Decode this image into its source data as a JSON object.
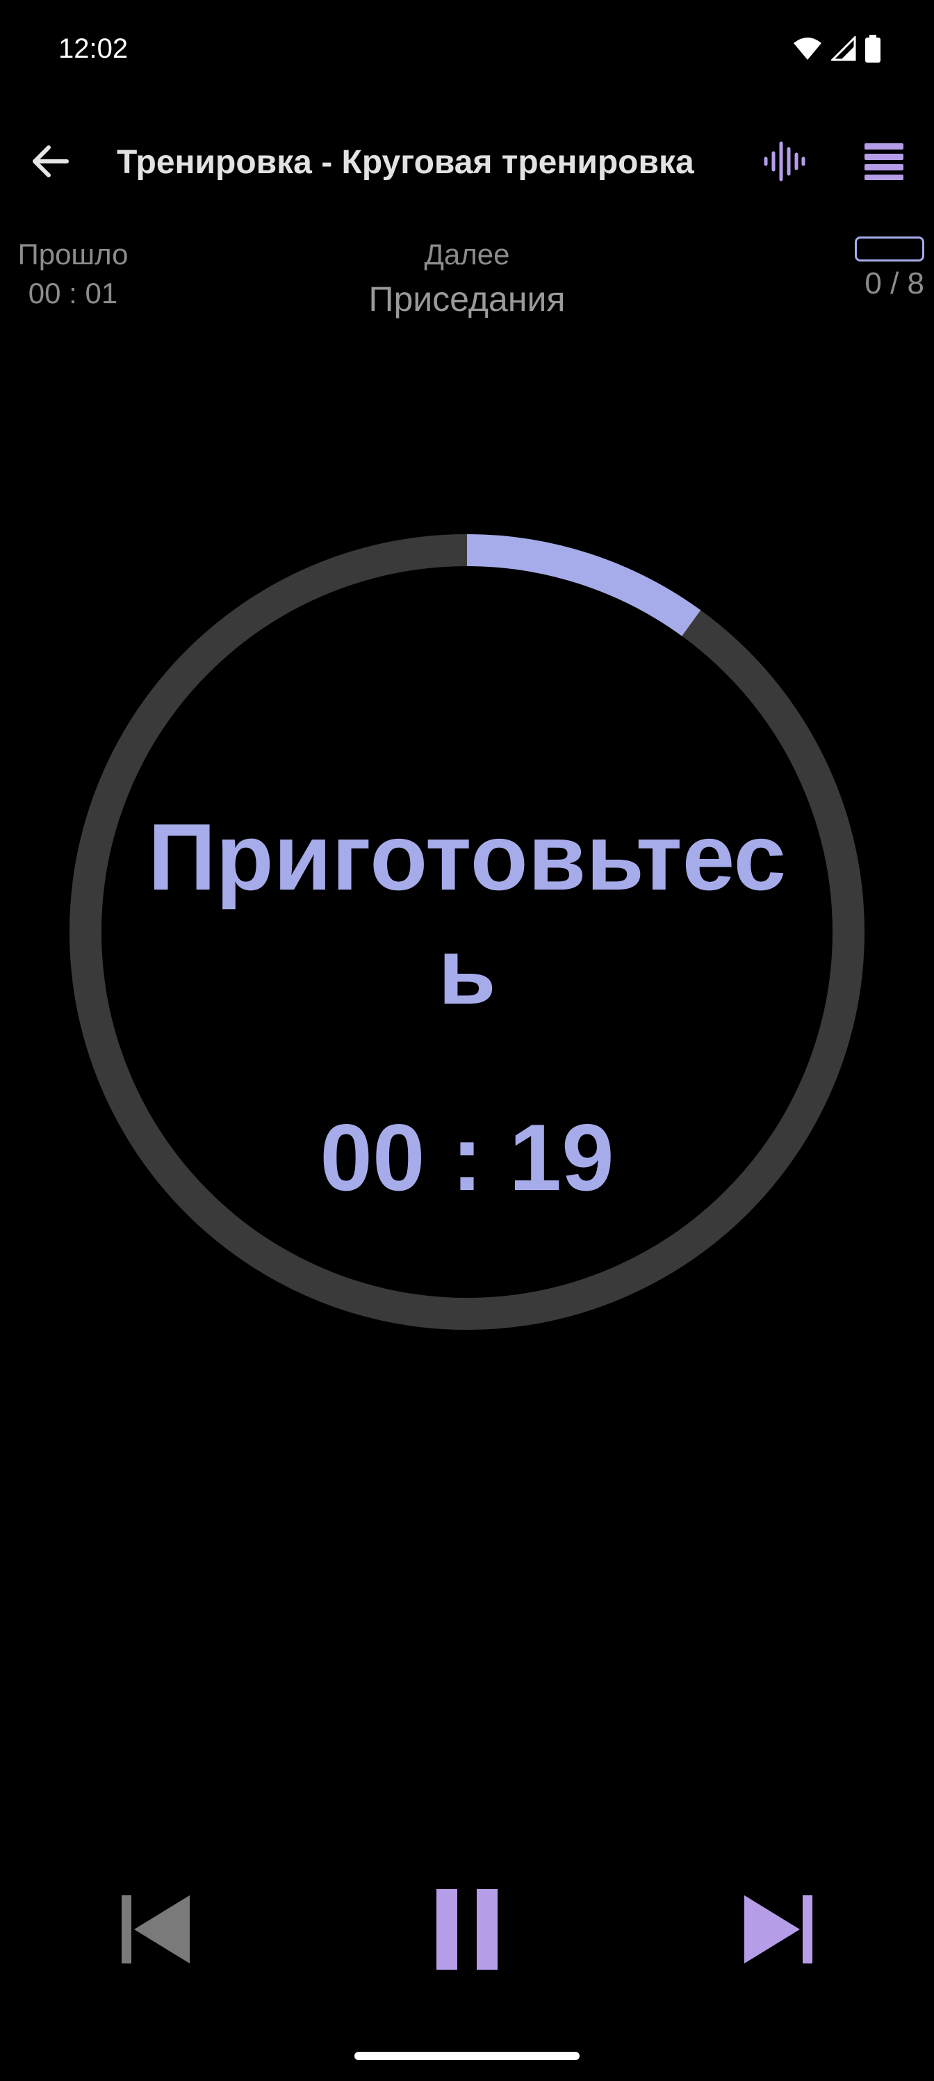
{
  "status_bar": {
    "time": "12:02",
    "icons": [
      "wifi-icon",
      "signal-icon",
      "battery-icon"
    ]
  },
  "app_bar": {
    "title": "Тренировка - Круговая тренировка",
    "back_icon": "arrow-left-icon",
    "voice_icon": "audio-wave-icon",
    "menu_icon": "list-icon"
  },
  "info": {
    "elapsed_label": "Прошло",
    "elapsed_value": "00 : 01",
    "next_label": "Далее",
    "next_value": "Приседания",
    "progress_count": "0 / 8",
    "progress_fraction": 0
  },
  "timer": {
    "phase_text": "Приготовьтесь",
    "remaining": "00 : 19",
    "ring_progress": 0.1
  },
  "controls": {
    "prev_icon": "skip-previous-icon",
    "pause_icon": "pause-icon",
    "next_icon": "skip-next-icon"
  },
  "colors": {
    "accent": "#a6abe9",
    "accent_icon": "#b69de8",
    "ring_track": "#3a3a3a",
    "muted_text": "#8c8c8c",
    "background": "#000000"
  }
}
